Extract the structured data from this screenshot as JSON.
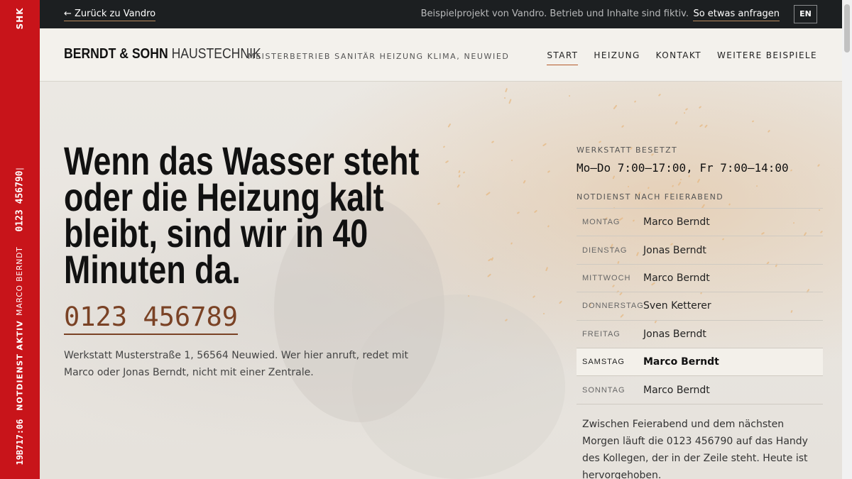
{
  "rail": {
    "shk": "SHK",
    "phone": "0123 456790",
    "name": "MARCO BERNDT",
    "status": "NOTDIENST AKTIV",
    "time": "19B717:06"
  },
  "topbar": {
    "back_link": "← Zurück zu Vandro",
    "disclaimer": "Beispielprojekt von Vandro. Betrieb und Inhalte sind fiktiv.",
    "request_link": "So etwas anfragen",
    "lang": "EN"
  },
  "header": {
    "brand_strong": "BERNDT & SOHN",
    "brand_light": "HAUSTECHNIK",
    "tagline": "MEISTERBETRIEB SANITÄR HEIZUNG KLIMA, NEUWIED",
    "nav": [
      "START",
      "HEIZUNG",
      "KONTAKT",
      "WEITERE BEISPIELE"
    ]
  },
  "hero": {
    "headline": "Wenn das Wasser steht oder die Heizung kalt bleibt, sind wir in 40 Minuten da.",
    "phone": "0123 456789",
    "address": "Werkstatt Musterstraße 1, 56564 Neuwied. Wer hier anruft, redet mit Marco oder Jonas Berndt, nicht mit einer Zentrale."
  },
  "sidebar": {
    "workshop_label": "WERKSTATT BESETZT",
    "hours": "Mo–Do 7:00–17:00, Fr 7:00–14:00",
    "notdienst_label": "NOTDIENST NACH FEIERABEND",
    "schedule": [
      {
        "day": "MONTAG",
        "name": "Marco Berndt"
      },
      {
        "day": "DIENSTAG",
        "name": "Jonas Berndt"
      },
      {
        "day": "MITTWOCH",
        "name": "Marco Berndt"
      },
      {
        "day": "DONNERSTAG",
        "name": "Sven Ketterer"
      },
      {
        "day": "FREITAG",
        "name": "Jonas Berndt"
      },
      {
        "day": "SAMSTAG",
        "name": "Marco Berndt"
      },
      {
        "day": "SONNTAG",
        "name": "Marco Berndt"
      }
    ],
    "highlighted_day": "SAMSTAG",
    "note": "Zwischen Feierabend und dem nächsten Morgen läuft die 0123 456790 auf das Handy des Kollegen, der in der Zeile steht. Heute ist hervorgehoben."
  },
  "colors": {
    "rail_red": "#c8141a",
    "topbar_dark": "#1c1f21",
    "phone_brown": "#7a4225",
    "nav_underline": "#b45a2a"
  }
}
